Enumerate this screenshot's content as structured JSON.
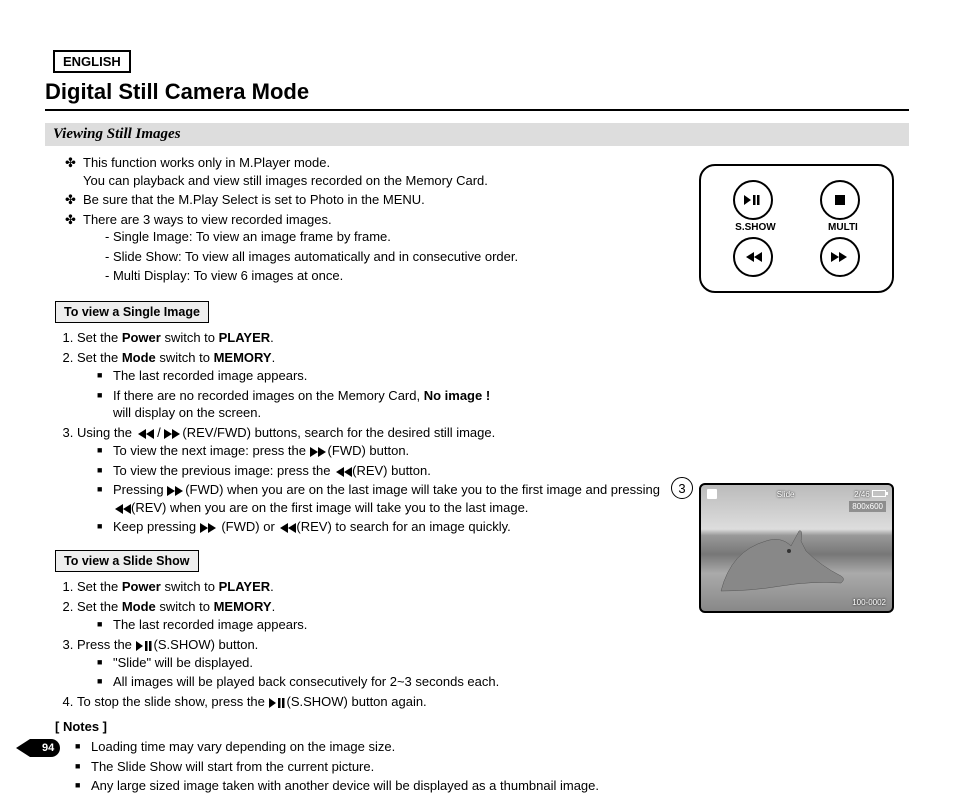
{
  "lang": "ENGLISH",
  "title": "Digital Still Camera Mode",
  "section": "Viewing Still Images",
  "intro": {
    "b1a": "This function works only in M.Player mode.",
    "b1b": "You can playback and view still images recorded on the Memory Card.",
    "b2": "Be sure that the M.Play Select is set to Photo in the MENU.",
    "b3": "There are 3 ways to view recorded images.",
    "d1": "Single Image: To view an image frame by frame.",
    "d2": "Slide Show: To view all images automatically and in consecutive order.",
    "d3": "Multi Display: To view 6 images at once."
  },
  "single": {
    "heading": "To view a Single Image",
    "s1_pre": "Set the ",
    "s1_b1": "Power",
    "s1_mid": " switch to ",
    "s1_b2": "PLAYER",
    "s1_end": ".",
    "s2_pre": "Set the ",
    "s2_b1": "Mode",
    "s2_mid": " switch to ",
    "s2_b2": "MEMORY",
    "s2_end": ".",
    "s2a": "The last recorded image appears.",
    "s2b_pre": "If there are no recorded images on the Memory Card, ",
    "s2b_b": "No image !",
    "s2b_post": "will display on the screen.",
    "s3_pre": "Using the ",
    "s3_mid": " / ",
    "s3_post": "(REV/FWD) buttons, search for the desired still image.",
    "s3a_pre": "To view the next image: press the ",
    "s3a_post": "(FWD) button.",
    "s3b_pre": "To view the previous image: press the ",
    "s3b_post": "(REV) button.",
    "s3c_pre": "Pressing ",
    "s3c_mid1": "(FWD) when you are on the last image will take you to the first image and pressing ",
    "s3c_mid2": "(REV) when you are on the first image will take you to the last image.",
    "s3d_pre": "Keep pressing ",
    "s3d_mid": " (FWD) or ",
    "s3d_post": "(REV) to search for an image quickly."
  },
  "slide": {
    "heading": "To view a Slide Show",
    "s1_pre": "Set the ",
    "s1_b1": "Power",
    "s1_mid": " switch to ",
    "s1_b2": "PLAYER",
    "s1_end": ".",
    "s2_pre": "Set the ",
    "s2_b1": "Mode",
    "s2_mid": " switch to ",
    "s2_b2": "MEMORY",
    "s2_end": ".",
    "s2a": "The last recorded image appears.",
    "s3_pre": "Press the ",
    "s3_post": "(S.SHOW) button.",
    "s3a": "\"Slide\" will be displayed.",
    "s3b": "All images will be played back consecutively for 2~3 seconds each.",
    "s4_pre": "To stop the slide show, press the ",
    "s4_post": "(S.SHOW) button again."
  },
  "notes": {
    "heading": "[ Notes ]",
    "n1": "Loading time may vary depending on the image size.",
    "n2": "The Slide Show will start from the current picture.",
    "n3": "Any large sized image taken with another device will be displayed as a thumbnail image."
  },
  "panel": {
    "sshow": "S.SHOW",
    "multi": "MULTI"
  },
  "preview": {
    "step": "3",
    "label": "Slide",
    "counter": "2/46",
    "resolution": "800x600",
    "fileno": "100-0002"
  },
  "page": "94"
}
